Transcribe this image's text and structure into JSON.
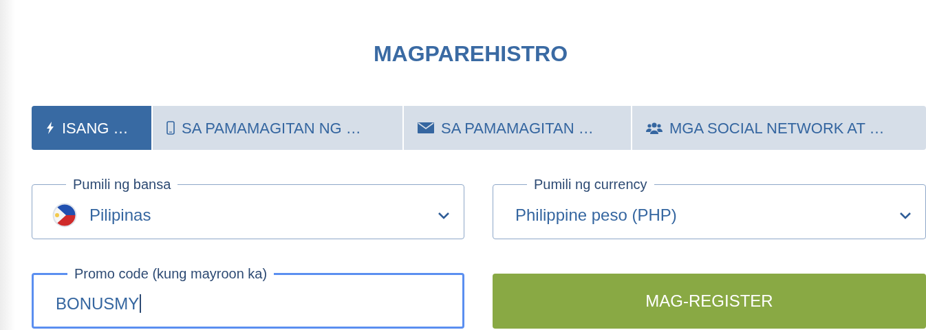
{
  "title": "MAGPAREHISTRO",
  "tabs": [
    {
      "label": "ISANG …",
      "kind": "bolt",
      "selected": true
    },
    {
      "label": "SA PAMAMAGITAN NG …",
      "kind": "phone",
      "selected": false
    },
    {
      "label": "SA PAMAMAGITAN …",
      "kind": "mail",
      "selected": false
    },
    {
      "label": "MGA SOCIAL NETWORK AT …",
      "kind": "users",
      "selected": false
    }
  ],
  "fields": [
    {
      "kind": "select",
      "label": "Pumili ng bansa",
      "value": "Pilipinas",
      "flag": true,
      "focused": false
    },
    {
      "kind": "select",
      "label": "Pumili ng currency",
      "value": "Philippine peso (PHP)",
      "flag": false,
      "focused": false
    },
    {
      "kind": "input",
      "label": "Promo code (kung mayroon ka)",
      "value": "BONUSMY",
      "focused": true
    },
    {
      "kind": "button",
      "label": "MAG-REGISTER"
    }
  ]
}
